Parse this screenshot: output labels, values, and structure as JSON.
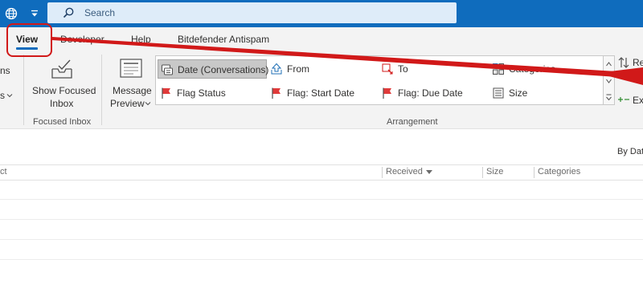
{
  "titlebar": {
    "search_placeholder": "Search",
    "icons": [
      "globe-icon",
      "quick-access-dropdown-icon",
      "search-icon"
    ],
    "color": "#0f6cbd"
  },
  "tabs": [
    {
      "label": "View",
      "active": true
    },
    {
      "label": "Developer",
      "active": false
    },
    {
      "label": "Help",
      "active": false
    },
    {
      "label": "Bitdefender Antispam",
      "active": false
    }
  ],
  "ribbon": {
    "left_cut": {
      "line1": "ns",
      "line2": "s"
    },
    "focused_inbox": {
      "button_label_1": "Show Focused",
      "button_label_2": "Inbox",
      "group_label": "Focused Inbox"
    },
    "message_preview": {
      "label_1": "Message",
      "label_2": "Preview"
    },
    "arrangement": {
      "group_label": "Arrangement",
      "items": [
        {
          "label": "Date (Conversations)",
          "icon": "conversation-icon",
          "selected": true
        },
        {
          "label": "From",
          "icon": "from-icon",
          "selected": false
        },
        {
          "label": "To",
          "icon": "to-icon",
          "selected": false
        },
        {
          "label": "Categories",
          "icon": "categories-icon",
          "selected": false
        },
        {
          "label": "Flag Status",
          "icon": "flag-icon",
          "selected": false
        },
        {
          "label": "Flag: Start Date",
          "icon": "flag-icon",
          "selected": false
        },
        {
          "label": "Flag: Due Date",
          "icon": "flag-icon",
          "selected": false
        },
        {
          "label": "Size",
          "icon": "size-icon",
          "selected": false
        }
      ]
    },
    "right_cut": {
      "reverse": "Re",
      "expand": "Ex"
    }
  },
  "list": {
    "sort_label": "By Dat",
    "columns": [
      {
        "label": "ct"
      },
      {
        "label": "Received"
      },
      {
        "label": "Size"
      },
      {
        "label": "Categories"
      }
    ]
  },
  "annotation": {
    "color": "#d11919"
  }
}
